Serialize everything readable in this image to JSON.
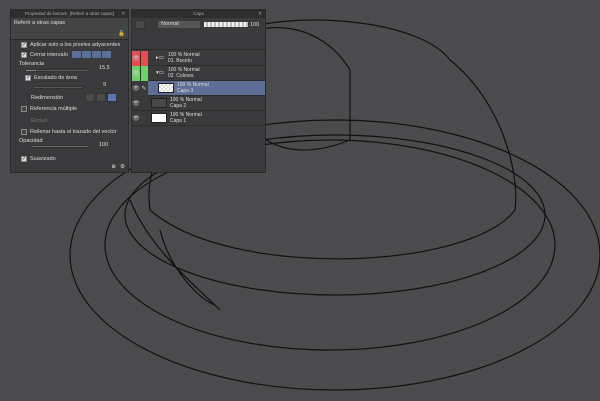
{
  "tool_panel": {
    "title": "Propiedad de herram. [Referir a otras capas]",
    "tool_name": "Referir a otras capas",
    "apply_adjacent": "Aplicar solo a los píxeles adyacentes",
    "close_gap": "Cerrar intervalo",
    "tolerance_label": "Tolerancia",
    "tolerance_value": "15.5",
    "tolerance_fraction": 0.155,
    "area_scaling": "Escalado de área",
    "area_scaling_value": "9",
    "resize_label": "Redimensión",
    "multi_ref": "Referencia múltiple",
    "exclude_label": "Excluir",
    "fill_vector": "Rellenar hasta el trazado del vector",
    "opacity_label": "Opacidad",
    "opacity_value": "100",
    "antialias": "Suavizado"
  },
  "layer_panel": {
    "title": "Capa",
    "blend_mode": "Normal",
    "opacity_value": "100",
    "layers": [
      {
        "mode": "100 % Normal",
        "name": "01. Boceto",
        "color": "#e05050",
        "folder": true
      },
      {
        "mode": "100 % Normal",
        "name": "02. Colores",
        "color": "#70d070",
        "folder": true
      },
      {
        "mode": "100 % Normal",
        "name": "Capa 3",
        "selected": true
      },
      {
        "mode": "100 % Normal",
        "name": "Capa 2"
      },
      {
        "mode": "100 % Normal",
        "name": "Capa 1"
      }
    ]
  }
}
